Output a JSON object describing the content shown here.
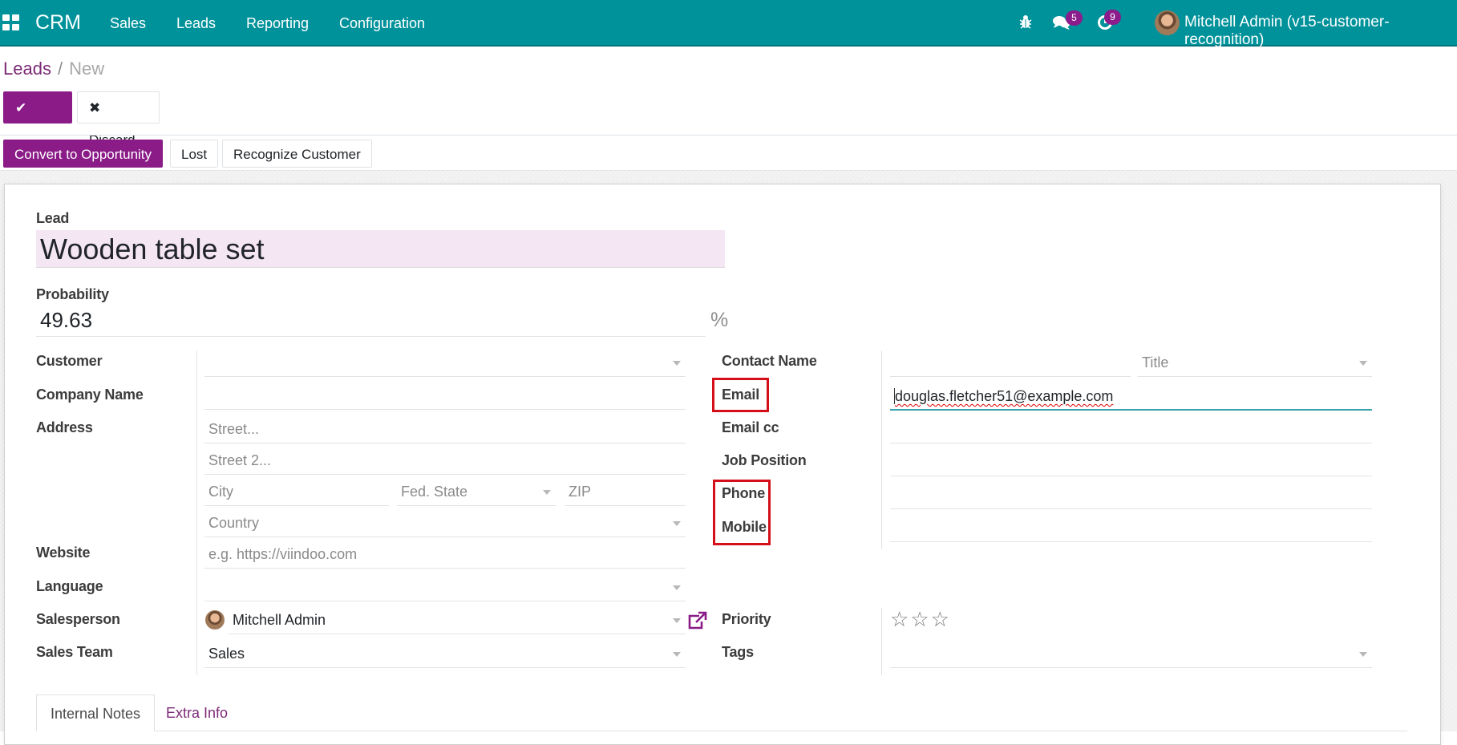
{
  "navbar": {
    "brand": "CRM",
    "menu": [
      "Sales",
      "Leads",
      "Reporting",
      "Configuration"
    ],
    "icons": {
      "apps": "apps-grid-icon",
      "debug": "bug-icon",
      "messages": "chat-icon",
      "activities": "clock-icon"
    },
    "messages_count": "5",
    "activities_count": "9",
    "user": "Mitchell Admin (v15-customer-recognition)"
  },
  "breadcrumb": {
    "parent": "Leads",
    "separator": "/",
    "current": "New"
  },
  "buttons": {
    "save": "Save",
    "discard": "Discard",
    "convert": "Convert to Opportunity",
    "lost": "Lost",
    "recognize": "Recognize Customer"
  },
  "form": {
    "lead_label": "Lead",
    "lead_name": "Wooden table set",
    "probability_label": "Probability",
    "probability": "49.63",
    "percent": "%",
    "left": {
      "customer": {
        "label": "Customer",
        "value": ""
      },
      "company": {
        "label": "Company Name",
        "value": ""
      },
      "address": {
        "label": "Address",
        "street": "Street...",
        "street2": "Street 2...",
        "city": "City",
        "state": "Fed. State",
        "zip": "ZIP",
        "country": "Country"
      },
      "website": {
        "label": "Website",
        "placeholder": "e.g. https://viindoo.com"
      },
      "language": {
        "label": "Language",
        "value": ""
      },
      "salesperson": {
        "label": "Salesperson",
        "value": "Mitchell Admin"
      },
      "sales_team": {
        "label": "Sales Team",
        "value": "Sales"
      }
    },
    "right": {
      "contact": {
        "label": "Contact Name",
        "title_placeholder": "Title"
      },
      "email": {
        "label": "Email",
        "value": "douglas.fletcher51@example.com"
      },
      "email_cc": {
        "label": "Email cc",
        "value": ""
      },
      "job": {
        "label": "Job Position",
        "value": ""
      },
      "phone": {
        "label": "Phone",
        "value": ""
      },
      "mobile": {
        "label": "Mobile",
        "value": ""
      },
      "priority": {
        "label": "Priority",
        "stars": 3,
        "value": 0
      },
      "tags": {
        "label": "Tags",
        "value": ""
      }
    }
  },
  "tabs": [
    "Internal Notes",
    "Extra Info"
  ],
  "colors": {
    "navbar": "#00929a",
    "primary": "#8a1b87",
    "highlight": "#d40f1a"
  }
}
